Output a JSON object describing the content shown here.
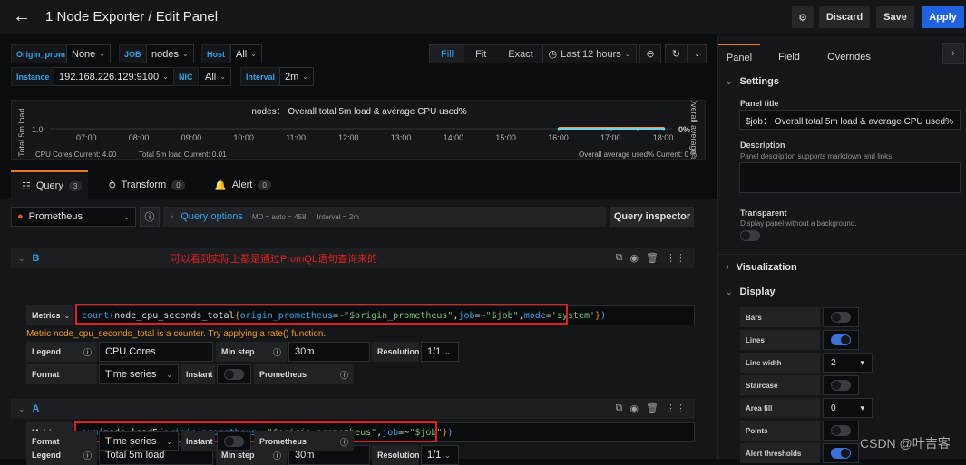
{
  "header": {
    "title": "1 Node Exporter / Edit Panel",
    "discard": "Discard",
    "save": "Save",
    "apply": "Apply"
  },
  "variables": [
    {
      "label": "Origin_prom",
      "value": "None"
    },
    {
      "label": "JOB",
      "value": "nodes"
    },
    {
      "label": "Host",
      "value": "All"
    },
    {
      "label": "Instance",
      "value": "192.168.226.129:9100"
    },
    {
      "label": "NIC",
      "value": "All"
    },
    {
      "label": "Interval",
      "value": "2m"
    }
  ],
  "toolbar": {
    "fill": "Fill",
    "fit": "Fit",
    "exact": "Exact",
    "time_range": "Last 12 hours"
  },
  "chart_data": {
    "type": "line",
    "title": "nodes： Overall total 5m load & average CPU used%",
    "ylabel": "Total 5m load",
    "y2label": "Overall average used%",
    "y_tick": "1.0",
    "y2_tick": "0%",
    "x_ticks": [
      "07:00",
      "08:00",
      "09:00",
      "10:00",
      "11:00",
      "12:00",
      "13:00",
      "14:00",
      "15:00",
      "16:00",
      "17:00",
      "18:00"
    ],
    "series": [
      {
        "name": "CPU Cores",
        "legend": "CPU Cores  Current: 4.00",
        "color": "#eab839"
      },
      {
        "name": "Total 5m load",
        "legend": "Total 5m load  Current: 0.01",
        "color": "#ef843c"
      },
      {
        "name": "Overall average used%",
        "legend": "Overall average used%  Current: 0 %",
        "color": "#6ed0e0"
      }
    ],
    "data_span": [
      "16:00",
      "18:00"
    ]
  },
  "tabs": [
    {
      "label": "Query",
      "count": "3"
    },
    {
      "label": "Transform",
      "count": "0"
    },
    {
      "label": "Alert",
      "count": "0"
    }
  ],
  "query_bar": {
    "datasource": "Prometheus",
    "options_label": "Query options",
    "md": "MD = auto = 458",
    "interval": "Interval = 2m",
    "inspector": "Query inspector"
  },
  "annotation": "可以看到实际上都是通过PromQL语句查询来的",
  "queries": [
    {
      "ref": "B",
      "metrics_label": "Metrics",
      "expr_parts": [
        "count(",
        "node_cpu_seconds_total",
        "{",
        "origin_prometheus",
        "=~",
        "\"$origin_prometheus\"",
        ",",
        "job",
        "=~",
        "\"$job\"",
        ", ",
        "mode",
        "=",
        "'system'",
        "}",
        ")"
      ],
      "warning": "Metric node_cpu_seconds_total is a counter. Try applying a rate() function.",
      "legend_label": "Legend",
      "legend": "CPU Cores",
      "min_step_label": "Min step",
      "min_step": "30m",
      "resolution_label": "Resolution",
      "resolution": "1/1",
      "format_label": "Format",
      "format": "Time series",
      "instant_label": "Instant",
      "prometheus_label": "Prometheus"
    },
    {
      "ref": "A",
      "metrics_label": "Metrics",
      "expr_parts": [
        "sum(",
        "node_load5",
        "{",
        "origin_prometheus",
        "=~",
        "\"$origin_prometheus\"",
        ",",
        "job",
        "=~",
        "\"$job\"",
        "}",
        ")"
      ],
      "legend_label": "Legend",
      "legend": "Total 5m load",
      "min_step_label": "Min step",
      "min_step": "30m",
      "resolution_label": "Resolution",
      "resolution": "1/1",
      "format_label": "Format",
      "format": "Time series",
      "instant_label": "Instant",
      "prometheus_label": "Prometheus"
    }
  ],
  "right": {
    "tabs": [
      "Panel",
      "Field",
      "Overrides"
    ],
    "settings": "Settings",
    "panel_title_label": "Panel title",
    "panel_title": "$job： Overall total 5m load & average CPU used%",
    "description_label": "Description",
    "description_sub": "Panel description supports markdown and links.",
    "transparent_label": "Transparent",
    "transparent_sub": "Display panel without a background.",
    "visualization": "Visualization",
    "display": "Display",
    "display_items": [
      {
        "label": "Bars",
        "type": "toggle",
        "on": false
      },
      {
        "label": "Lines",
        "type": "toggle",
        "on": true
      },
      {
        "label": "Line width",
        "type": "select",
        "value": "2"
      },
      {
        "label": "Staircase",
        "type": "toggle",
        "on": false
      },
      {
        "label": "Area fill",
        "type": "select",
        "value": "0"
      },
      {
        "label": "Points",
        "type": "toggle",
        "on": false
      },
      {
        "label": "Alert thresholds",
        "type": "toggle",
        "on": true
      }
    ]
  },
  "watermark": "CSDN @叶吉客"
}
